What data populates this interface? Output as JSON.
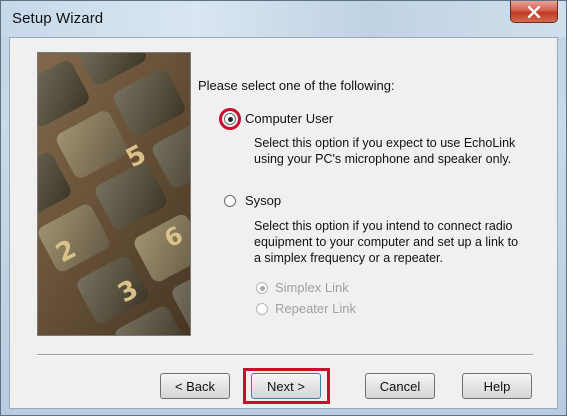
{
  "window": {
    "title": "Setup Wizard",
    "close_icon": "close-icon"
  },
  "prompt": "Please select one of the following:",
  "options": [
    {
      "label": "Computer User",
      "selected": true,
      "description_lines": [
        "Select this option if you expect to use EchoLink",
        "using your PC's microphone and speaker only."
      ]
    },
    {
      "label": "Sysop",
      "selected": false,
      "description_lines": [
        "Select this option if you intend to connect radio",
        "equipment to your computer and set up a link to",
        "a simplex frequency or a repeater."
      ]
    }
  ],
  "sub_options": [
    {
      "label": "Simplex Link",
      "selected": true,
      "enabled": false
    },
    {
      "label": "Repeater Link",
      "selected": false,
      "enabled": false
    }
  ],
  "buttons": {
    "back": "< Back",
    "next": "Next >",
    "cancel": "Cancel",
    "help": "Help"
  },
  "highlight_color": "#c8102e"
}
